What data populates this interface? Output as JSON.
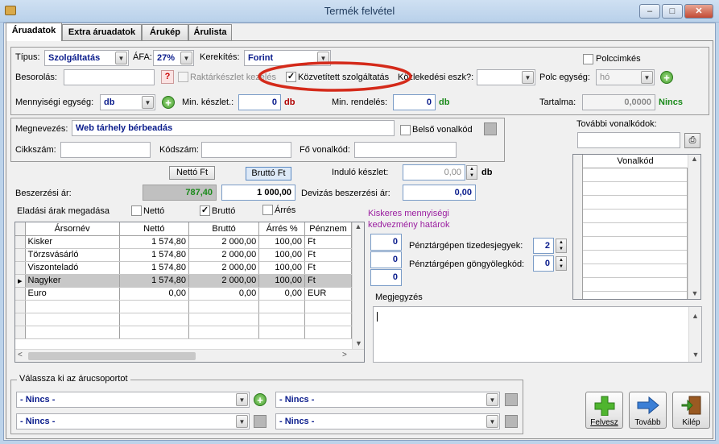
{
  "window": {
    "title": "Termék felvétel",
    "minimize": "–",
    "maximize": "□",
    "close": "✕"
  },
  "tabs": [
    "Áruadatok",
    "Extra áruadatok",
    "Árukép",
    "Árulista"
  ],
  "row1": {
    "tipus_label": "Típus:",
    "tipus_value": "Szolgáltatás",
    "afa_label": "ÁFA:",
    "afa_value": "27%",
    "kerekites_label": "Kerekítés:",
    "kerekites_value": "Forint",
    "polccimkes_label": "Polccimkés"
  },
  "row2": {
    "besorolas_label": "Besorolás:",
    "besorolas_button": "?",
    "raktarkeszlet_label": "Raktárkészlet kezelés",
    "kozvetitett_label": "Közvetített szolgáltatás",
    "kozlekedesi_label": "Közlekedési eszk?:",
    "polc_egyseg_label": "Polc egység:",
    "polc_egyseg_value": "hó"
  },
  "row3": {
    "mennyisegi_label": "Mennyiségi egység:",
    "mennyisegi_value": "db",
    "min_keszlet_label": "Min. készlet.:",
    "min_keszlet_value": "0",
    "min_keszlet_unit": "db",
    "min_rendeles_label": "Min. rendelés:",
    "min_rendeles_value": "0",
    "min_rendeles_unit": "db",
    "tartalma_label": "Tartalma:",
    "tartalma_value": "0,0000",
    "tartalma_unit": "Nincs"
  },
  "naming": {
    "megnevezes_label": "Megnevezés:",
    "megnevezes_value": "Web tárhely bérbeadás",
    "belso_vonalkod_label": "Belső vonalkód",
    "cikkszam_label": "Cikkszám:",
    "kodszam_label": "Kódszám:",
    "fo_vonalkod_label": "Fő vonalkód:"
  },
  "barcodes": {
    "label": "További vonalkódok:",
    "column": "Vonalkód"
  },
  "pricing": {
    "netto_button": "Nettó Ft",
    "brutto_button": "Bruttó Ft",
    "indulo_label": "Induló készlet:",
    "indulo_value": "0,00",
    "indulo_unit": "db",
    "beszerzesi_label": "Beszerzési ár:",
    "beszerzesi_netto": "787,40",
    "beszerzesi_brutto": "1 000,00",
    "devizas_label": "Devizás beszerzési ár:",
    "devizas_value": "0,00",
    "eladasi_label": "Eladási árak megadása",
    "opt_netto": "Nettó",
    "opt_brutto": "Bruttó",
    "opt_arres": "Árrés"
  },
  "price_table": {
    "headers": [
      "Ársornév",
      "Nettó",
      "Bruttó",
      "Árrés %",
      "Pénznem"
    ],
    "rows": [
      [
        "Kisker",
        "1 574,80",
        "2 000,00",
        "100,00",
        "Ft"
      ],
      [
        "Törzsvásárló",
        "1 574,80",
        "2 000,00",
        "100,00",
        "Ft"
      ],
      [
        "Viszonteladó",
        "1 574,80",
        "2 000,00",
        "100,00",
        "Ft"
      ],
      [
        "Nagyker",
        "1 574,80",
        "2 000,00",
        "100,00",
        "Ft"
      ],
      [
        "Euro",
        "0,00",
        "0,00",
        "0,00",
        "EUR"
      ]
    ]
  },
  "discount": {
    "label1": "Kiskeres mennyiségi",
    "label2": "kedvezmény  határok",
    "values": [
      "0",
      "0",
      "0"
    ],
    "tizedes_label": "Pénztárgépen tizedesjegyek:",
    "tizedes_value": "2",
    "gongyoleg_label": "Pénztárgépen göngyölegkód:",
    "gongyoleg_value": "0"
  },
  "megjegyzes_label": "Megjegyzés",
  "groups": {
    "label": "Válassza ki az árucsoportot",
    "values": [
      "- Nincs -",
      "- Nincs -",
      "- Nincs -",
      "- Nincs -"
    ]
  },
  "actions": {
    "felvesz": "Felvesz",
    "tovabb": "Tovább",
    "kilep": "Kilép"
  },
  "colors": {
    "highlight_ring": "#d42a1a",
    "field_text": "#0a1c8c",
    "unit_red": "#b00000",
    "unit_green": "#1a8a1a"
  }
}
